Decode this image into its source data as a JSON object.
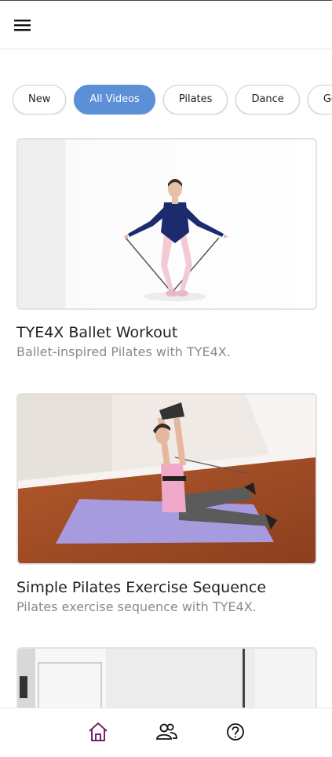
{
  "header": {
    "menu_icon": "hamburger-menu-icon"
  },
  "filters": [
    {
      "label": "New",
      "active": false
    },
    {
      "label": "All Videos",
      "active": true
    },
    {
      "label": "Pilates",
      "active": false
    },
    {
      "label": "Dance",
      "active": false
    },
    {
      "label": "Golf",
      "active": false
    }
  ],
  "videos": [
    {
      "title": "TYE4X Ballet Workout",
      "subtitle": "Ballet-inspired Pilates with TYE4X."
    },
    {
      "title": "Simple Pilates Exercise Sequence",
      "subtitle": "Pilates exercise sequence with TYE4X."
    }
  ],
  "bottom_nav": {
    "active_color": "#7a1f6e",
    "items": [
      {
        "icon": "home-icon",
        "active": true
      },
      {
        "icon": "users-icon",
        "active": false
      },
      {
        "icon": "help-circle-icon",
        "active": false
      }
    ]
  },
  "colors": {
    "accent": "#5b8fd6",
    "subtitle": "#8a8a8a"
  }
}
